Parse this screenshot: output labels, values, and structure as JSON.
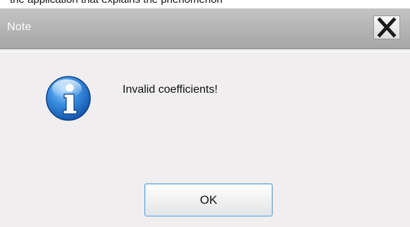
{
  "dialog": {
    "title": "Note",
    "message": "Invalid coefficients!",
    "ok_label": "OK",
    "close_symbol": "close-icon",
    "icon": "info-icon"
  },
  "background_caption": "the application that explains the phenomenon"
}
